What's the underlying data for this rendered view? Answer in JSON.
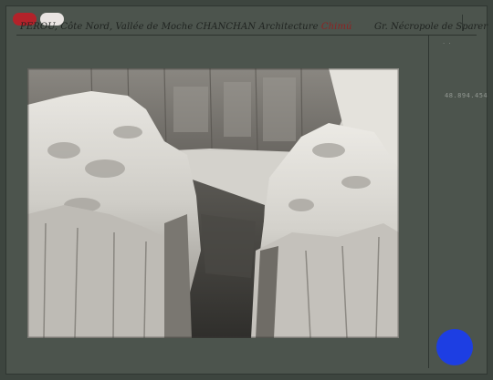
{
  "header": {
    "left_text": "PEROU, Côte Nord, Vallée de Moche CHANCHAN Architecture ",
    "left_text_red": "Chimú",
    "right_text": "Gr. Nécropole de Sparer"
  },
  "side": {
    "catalog_number": "48.894.454",
    "small_mark": "· ·"
  },
  "colors": {
    "background": "#4c544d",
    "sticker_red": "#b3222a",
    "sticker_white": "#e9e4e2",
    "blue_dot": "#1d3ee3",
    "header_red_text": "#8d2323"
  },
  "photo": {
    "subject": "adobe-wall-ruins"
  }
}
